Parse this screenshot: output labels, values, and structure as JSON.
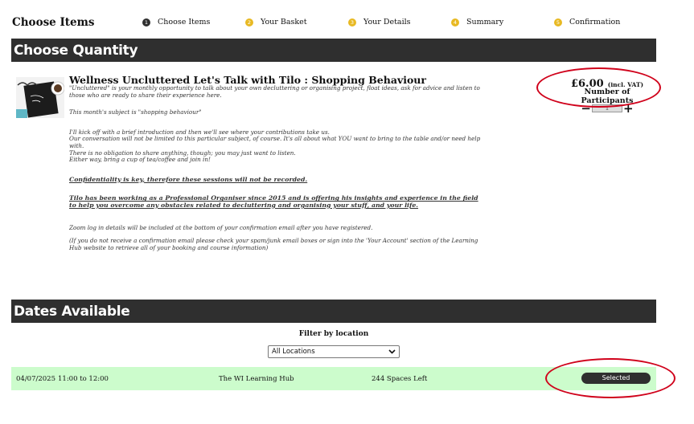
{
  "header": {
    "title": "Choose Items",
    "steps": [
      {
        "num": "1",
        "label": "Choose Items",
        "color": "#2f2f2f"
      },
      {
        "num": "2",
        "label": "Your Basket",
        "color": "#e8b923"
      },
      {
        "num": "3",
        "label": "Your Details",
        "color": "#e8b923"
      },
      {
        "num": "4",
        "label": "Summary",
        "color": "#e8b923"
      },
      {
        "num": "5",
        "label": "Confirmation",
        "color": "#e8b923"
      }
    ]
  },
  "quantity": {
    "heading": "Choose Quantity",
    "product_title": "Wellness Uncluttered Let's Talk with Tilo : Shopping Behaviour",
    "description": [
      "\"Uncluttered\" is your monthly opportunity to talk about your own decluttering or organising project, float ideas, ask for advice and listen to those who are ready to share their experience here.",
      "This month's subject is \"shopping behaviour\"",
      "I'll kick off with a brief introduction and then we'll see where your contributions take us.",
      "Our conversation will not be limited to this particular subject, of course. It's all about what YOU want to bring to the table and/or need help with.",
      "There is no obligation to share anything, though; you may just want to listen.",
      "Either way, bring a cup of tea/coffee and join in!",
      "Confidentiality is key, therefore these sessions will not be recorded.",
      "Tilo has been working as a Professional Organiser since 2015 and is offering his insights and experience in the field to help you overcome any obstacles related to decluttering and organising your stuff, and your life.",
      "Zoom log in details will be included at the bottom of your confirmation email after you have registered.",
      "(If you do not receive a confirmation email please check your spam/junk email boxes or sign into  the 'Your Account' section of the Learning Hub website to retrieve all of your booking and course information)"
    ],
    "price": "£6.00",
    "vat_note": "(incl. VAT)",
    "participants_label": "Number of Participants",
    "minus": "−",
    "plus": "+",
    "qty_value": "1"
  },
  "dates": {
    "heading": "Dates Available",
    "filter_label": "Filter by location",
    "filter_value": "All Locations",
    "row": {
      "date": "04/07/2025",
      "time": "11:00 to 12:00",
      "location": "The WI Learning Hub",
      "spaces": "244 Spaces Left",
      "button": "Selected"
    }
  },
  "colors": {
    "band": "#2f2f2f",
    "row_bg": "#ccfccc",
    "step_yellow": "#e8b923",
    "annotation": "#d0021b"
  }
}
